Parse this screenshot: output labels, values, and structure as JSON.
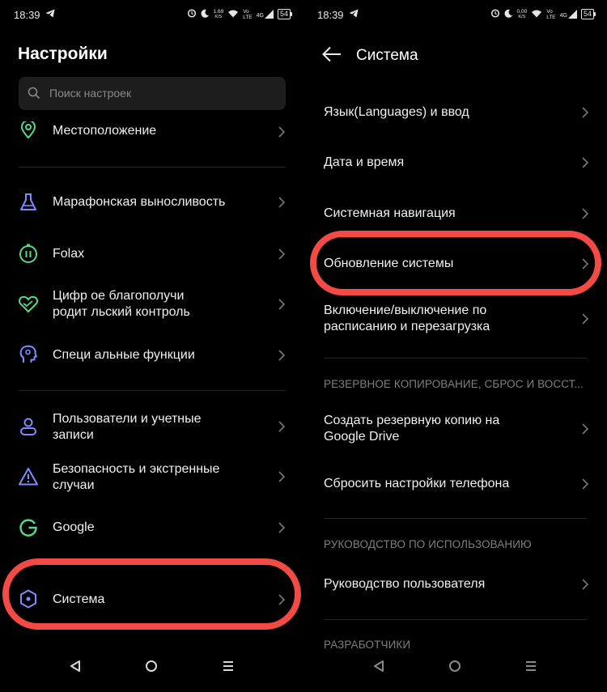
{
  "status_bar": {
    "time": "18:39",
    "left_speed": "1,69",
    "right_speed": "0,00",
    "speed_unit": "K/S",
    "net_top": "Vo",
    "net_bottom": "LTE",
    "signal": "4G",
    "battery": "54"
  },
  "settings_screen": {
    "title": "Настройки",
    "search_placeholder": "Поиск настроек",
    "items": [
      {
        "label": "Местоположение",
        "icon": "location-icon"
      },
      {
        "label": "Марафонская выносливость",
        "icon": "flask-icon"
      },
      {
        "label": "Folax",
        "icon": "folax-icon"
      },
      {
        "label": "Цифровое благополучие и родительский контроль",
        "line1": "Цифр  ое благополучи",
        "line2": "родит  льский контроль",
        "icon": "heart-icon"
      },
      {
        "label": "Специальные функции",
        "line1": "Специ  альные функции",
        "icon": "head-icon"
      },
      {
        "label": "Пользователи и учетные записи",
        "line1": "Пользователи и учетные",
        "line2": "записи",
        "icon": "user-icon"
      },
      {
        "label": "Безопасность и экстренные случаи",
        "line1": "Безопасность и экстренные",
        "line2": "случаи",
        "icon": "warning-icon"
      },
      {
        "label": "Google",
        "icon": "google-icon"
      },
      {
        "label": "Система",
        "icon": "hexagon-icon"
      }
    ]
  },
  "system_screen": {
    "title": "Система",
    "items": [
      {
        "label": "Язык(Languages) и ввод"
      },
      {
        "label": "Дата и время"
      },
      {
        "label": "Системная навигация"
      },
      {
        "label": "Обновление системы"
      },
      {
        "label": "Включение/выключение по расписанию и перезагрузка",
        "line1": "Включение/выключение по",
        "line2": "расписанию и перезагрузка"
      }
    ],
    "section_backup": "РЕЗЕРВНОЕ КОПИРОВАНИЕ, СБРОС И ВОССТ...",
    "backup_items": [
      {
        "label": "Создать резервную копию на Google Drive",
        "line1": "Создать резервную копию на",
        "line2": "Google Drive"
      },
      {
        "label": "Сбросить настройки телефона"
      }
    ],
    "section_guide": "РУКОВОДСТВО ПО ИСПОЛЬЗОВАНИЮ",
    "guide_items": [
      {
        "label": "Руководство пользователя"
      }
    ],
    "section_dev": "РАЗРАБОТЧИКИ"
  },
  "colors": {
    "highlight": "#f24a45",
    "icon_blue": "#7d8cff",
    "icon_green": "#57d98b",
    "icon_teal": "#49c5c0"
  }
}
